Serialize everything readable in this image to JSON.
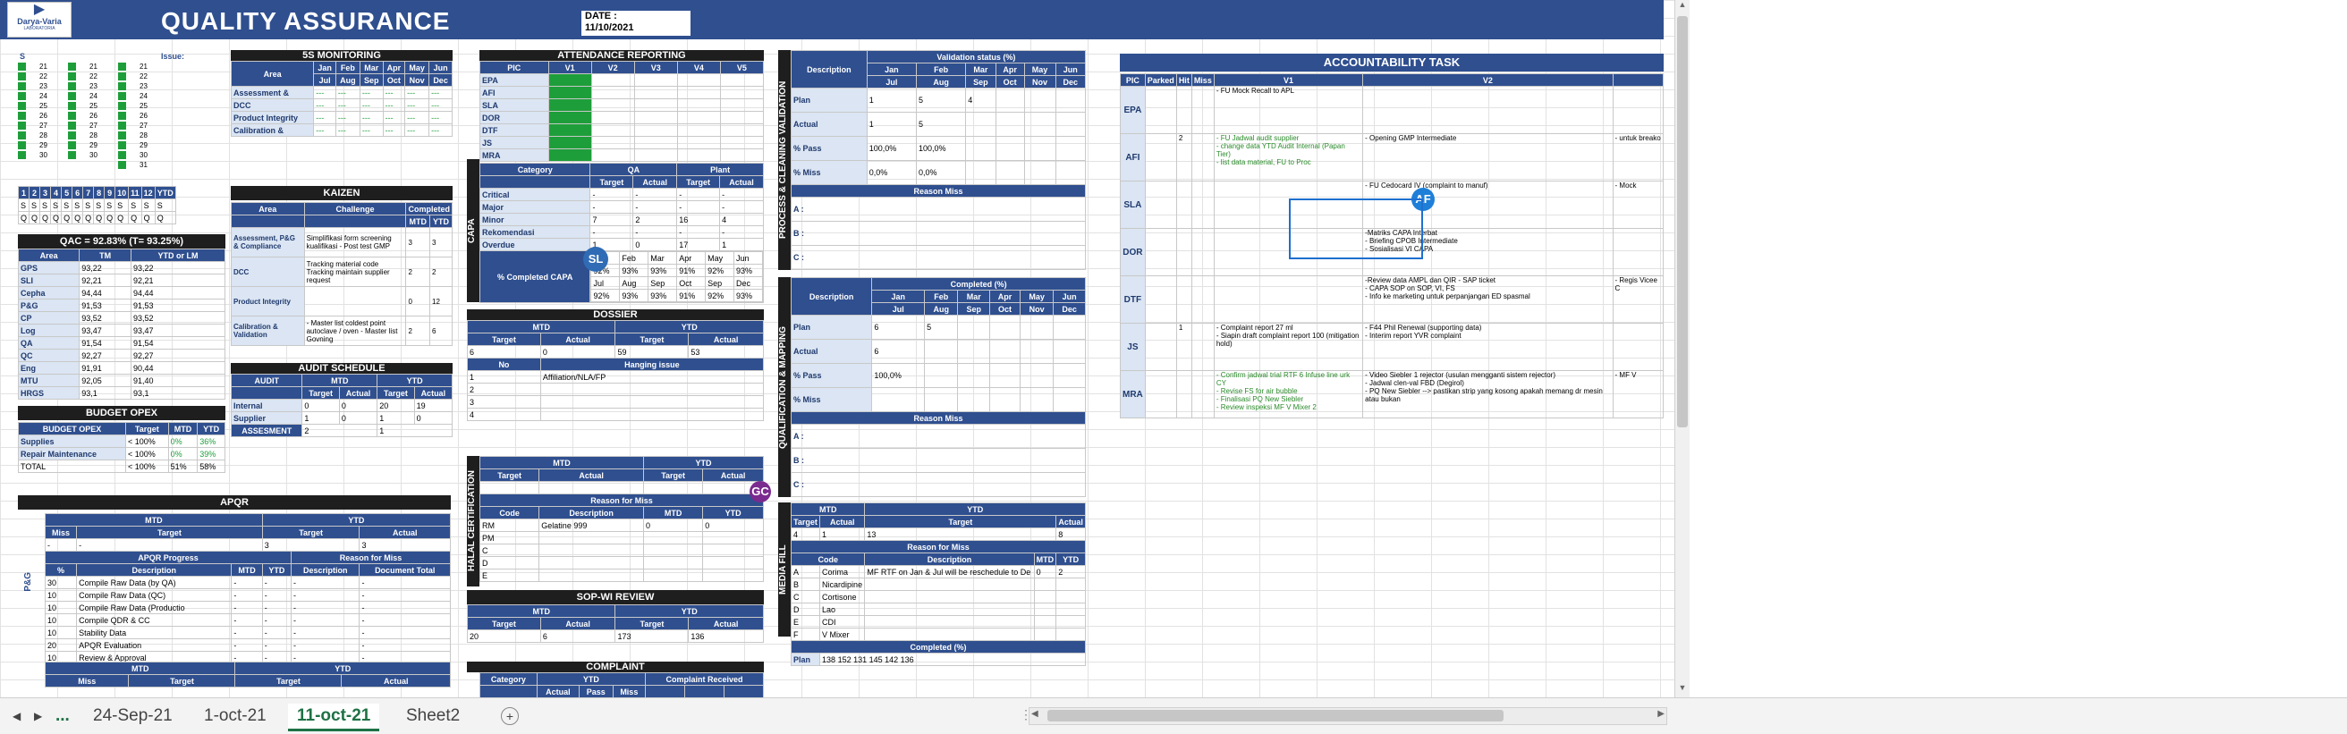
{
  "header": {
    "title": "QUALITY ASSURANCE",
    "logo_text": "Darya-Varia",
    "logo_sub": "LABORATORIA",
    "date_label": "DATE :",
    "date_value": "11/10/2021"
  },
  "calendar": {
    "issue_label": "Issue:",
    "col_s": "S",
    "col_q": "Q",
    "days": [
      "21",
      "22",
      "23",
      "24",
      "25",
      "26",
      "27",
      "28",
      "29",
      "30"
    ],
    "days2": [
      "21",
      "22",
      "23",
      "24",
      "25",
      "26",
      "27",
      "28",
      "29",
      "30"
    ],
    "days3": [
      "21",
      "22",
      "23",
      "24",
      "25",
      "26",
      "27",
      "28",
      "29",
      "30",
      "31"
    ]
  },
  "month_strip": {
    "months": [
      "1",
      "2",
      "3",
      "4",
      "5",
      "6",
      "7",
      "8",
      "9",
      "10",
      "11",
      "12",
      "YTD"
    ],
    "row_s": "S",
    "row_q": "Q"
  },
  "qac": {
    "title": "QAC = 92.83% (T= 93.25%)",
    "headers": [
      "Area",
      "TM",
      "YTD or LM"
    ],
    "rows": [
      [
        "GPS",
        "93,22",
        "93,22"
      ],
      [
        "SLI",
        "92,21",
        "92,21"
      ],
      [
        "Cepha",
        "94,44",
        "94,44"
      ],
      [
        "P&G",
        "91,53",
        "91,53"
      ],
      [
        "CP",
        "93,52",
        "93,52"
      ],
      [
        "Log",
        "93,47",
        "93,47"
      ],
      [
        "QA",
        "91,54",
        "91,54"
      ],
      [
        "QC",
        "92,27",
        "92,27"
      ],
      [
        "Eng",
        "91,91",
        "90,44"
      ],
      [
        "MTU",
        "92,05",
        "91,40"
      ],
      [
        "HRGS",
        "93,1",
        "93,1"
      ]
    ]
  },
  "budget": {
    "title": "BUDGET OPEX",
    "headers": [
      "BUDGET OPEX",
      "Target",
      "MTD",
      "YTD"
    ],
    "rows": [
      [
        "Supplies",
        "< 100%",
        "0%",
        "36%"
      ],
      [
        "Repair Maintenance",
        "< 100%",
        "0%",
        "39%"
      ]
    ],
    "total_label": "TOTAL",
    "total_target": "< 100%",
    "total_mtd": "51%",
    "total_ytd": "58%"
  },
  "s5": {
    "title": "5S MONITORING",
    "col_area": "Area",
    "months1": [
      "Jan",
      "Feb",
      "Mar",
      "Apr",
      "May",
      "Jun"
    ],
    "months2": [
      "Jul",
      "Aug",
      "Sep",
      "Oct",
      "Nov",
      "Dec"
    ],
    "rows": [
      "Assessment &",
      "DCC",
      "Product Integrity",
      "Calibration &"
    ],
    "dash": "---"
  },
  "kaizen": {
    "title": "KAIZEN",
    "headers": [
      "Area",
      "Challenge",
      "Completed",
      "MTD",
      "YTD"
    ],
    "rows": [
      [
        "Assessment, P&G & Compliance",
        "Simplifikasi form screening kualifikasi - Post test GMP",
        "3",
        "3"
      ],
      [
        "DCC",
        "Tracking material code Tracking maintain supplier request",
        "2",
        "2"
      ],
      [
        "Product Integrity",
        "",
        "0",
        "12"
      ],
      [
        "Calibration & Validation",
        "- Master list coldest point autoclave / oven - Master list Govning",
        "2",
        "6"
      ]
    ]
  },
  "audit": {
    "title": "AUDIT SCHEDULE",
    "label": "AUDIT",
    "mtd": "MTD",
    "ytd": "YTD",
    "target": "Target",
    "actual": "Actual",
    "rows": [
      [
        "Internal",
        "0",
        "0",
        "20",
        "19"
      ],
      [
        "Supplier",
        "1",
        "0",
        "1",
        "0"
      ]
    ],
    "assessment": "ASSESMENT",
    "a_target": "2",
    "a_actual": "1"
  },
  "attendance": {
    "title": "ATTENDANCE REPORTING",
    "pic": "PIC",
    "cols": [
      "V1",
      "V2",
      "V3",
      "V4",
      "V5"
    ],
    "rows": [
      "EPA",
      "AFI",
      "SLA",
      "DOR",
      "DTF",
      "JS",
      "MRA"
    ]
  },
  "capa": {
    "label": "CAPA",
    "category": "Category",
    "qa": "QA",
    "plant": "Plant",
    "target": "Target",
    "actual": "Actual",
    "rows": [
      [
        "Critical",
        "-",
        "-",
        "-",
        "-"
      ],
      [
        "Major",
        "-",
        "-",
        "-",
        "-"
      ],
      [
        "Minor",
        "7",
        "2",
        "16",
        "4"
      ],
      [
        "Rekomendasi",
        "-",
        "-",
        "-",
        "-"
      ],
      [
        "Overdue",
        "1",
        "0",
        "17",
        "1"
      ]
    ],
    "completed": "% Completed CAPA",
    "m1": [
      "Jan",
      "Feb",
      "Mar",
      "Apr",
      "May",
      "Jun"
    ],
    "v1": [
      "92%",
      "93%",
      "93%",
      "91%",
      "92%",
      "93%"
    ],
    "m2": [
      "Jul",
      "Aug",
      "Sep",
      "Oct",
      "Sep",
      "Dec"
    ],
    "v2": [
      "92%",
      "93%",
      "93%",
      "91%",
      "92%",
      "93%"
    ]
  },
  "dossier": {
    "title": "DOSSIER",
    "mtd": "MTD",
    "ytd": "YTD",
    "target": "Target",
    "actual": "Actual",
    "vals": [
      "6",
      "0",
      "59",
      "53"
    ],
    "no": "No",
    "hanging": "Hanging issue",
    "items": [
      "1",
      "2",
      "3",
      "4"
    ],
    "item1": "Affiliation/NLA/FP"
  },
  "halal": {
    "label": "HALAL CERTIFICATION",
    "mtd": "MTD",
    "ytd": "YTD",
    "target": "Target",
    "actual": "Actual",
    "reason": "Reason for Miss",
    "code": "Code",
    "desc": "Description",
    "codes": [
      "RM",
      "PM",
      "C",
      "D",
      "E"
    ],
    "rm_desc": "Gelatine 999",
    "mtd_v": "0",
    "ytd_v": "0"
  },
  "sop": {
    "title": "SOP-WI REVIEW",
    "mtd": "MTD",
    "ytd": "YTD",
    "target": "Target",
    "actual": "Actual",
    "vals": [
      "20",
      "6",
      "173",
      "136"
    ]
  },
  "complaint": {
    "title": "COMPLAINT",
    "category": "Category",
    "ytd": "YTD",
    "received": "Complaint Received",
    "sub": [
      "Actual",
      "Pass",
      "Miss"
    ]
  },
  "apqr": {
    "title": "APQR",
    "mtd": "MTD",
    "ytd": "YTD",
    "miss": "Miss",
    "target": "Target",
    "actual": "Actual",
    "vals": [
      "-",
      "-",
      "3",
      "3"
    ],
    "progress": "APQR Progress",
    "reason": "Reason for Miss",
    "headers": [
      "%",
      "Description",
      "MTD",
      "YTD",
      "Description",
      "Document Total"
    ],
    "side": "P&G",
    "rows": [
      [
        "30",
        "Compile Raw Data (by QA)"
      ],
      [
        "10",
        "Compile Raw Data (QC)"
      ],
      [
        "10",
        "Compile Raw Data (Productio"
      ],
      [
        "10",
        "Compile QDR & CC"
      ],
      [
        "10",
        "Stability Data"
      ],
      [
        "20",
        "APQR Evaluation"
      ],
      [
        "10",
        "Review & Approval"
      ]
    ]
  },
  "pcv": {
    "label": "PROCESS & CLEANING VALIDATION",
    "desc": "Description",
    "status": "Validation status (%)",
    "m1": [
      "Jan",
      "Feb",
      "Mar",
      "Apr",
      "May",
      "Jun"
    ],
    "m2": [
      "Jul",
      "Aug",
      "Sep",
      "Oct",
      "Nov",
      "Dec"
    ],
    "rows": [
      "Plan",
      "Actual",
      "% Pass",
      "% Miss"
    ],
    "plan": [
      "1",
      "5",
      "4"
    ],
    "actual": [
      "1",
      "5"
    ],
    "pass": [
      "100,0%",
      "100,0%"
    ],
    "miss": [
      "0,0%",
      "0,0%"
    ],
    "reason": "Reason Miss",
    "abc": [
      "A :",
      "B :",
      "C :"
    ]
  },
  "qm": {
    "label": "QUALIFICATION & MAPPING",
    "desc": "Description",
    "status": "Completed (%)",
    "rows": [
      "Plan",
      "Actual",
      "% Pass",
      "% Miss"
    ],
    "plan": [
      "6",
      "5"
    ],
    "actual": [
      "6"
    ],
    "pass": [
      "100,0%"
    ],
    "reason": "Reason Miss",
    "abc": [
      "A :",
      "B :",
      "C :"
    ]
  },
  "media": {
    "label": "MEDIA FILL",
    "mtd": "MTD",
    "ytd": "YTD",
    "target": "Target",
    "actual": "Actual",
    "vals": [
      "4",
      "1",
      "13",
      "8"
    ],
    "reason": "Reason for Miss",
    "code": "Code",
    "desc": "Description",
    "mtdc": "MTD",
    "ytdc": "YTD",
    "rows": [
      [
        "A",
        "Corima",
        "MF RTF on Jan & Jul will be reschedule to De",
        "0",
        "2"
      ],
      [
        "B",
        "Nicardipine",
        "",
        "",
        ""
      ],
      [
        "C",
        "Cortisone",
        "",
        "",
        ""
      ],
      [
        "D",
        "Lao",
        "",
        "",
        ""
      ],
      [
        "E",
        "CDI",
        "",
        "",
        ""
      ],
      [
        "F",
        "V Mixer",
        "",
        "",
        ""
      ]
    ],
    "completed": "Completed (%)",
    "plan": "Plan",
    "pvals": [
      "138",
      "152",
      "131",
      "145",
      "142",
      "136"
    ]
  },
  "account": {
    "title": "ACCOUNTABILITY TASK",
    "headers": [
      "PIC",
      "Parked",
      "Hit",
      "Miss",
      "V1",
      "V2"
    ],
    "rows": [
      {
        "pic": "EPA",
        "parked": "",
        "hit": "",
        "miss": "",
        "v1": "- FU Mock Recall to APL",
        "v2": "",
        "v3": ""
      },
      {
        "pic": "AFI",
        "parked": "",
        "hit": "2",
        "miss": "",
        "v1": "- FU Jadwal audit supplier\n- change data YTD Audit Internal (Papan Tier)\n- list data material, FU to Proc",
        "v2": "- Opening GMP Intermediate",
        "v3": "- untuk breako"
      },
      {
        "pic": "SLA",
        "parked": "",
        "hit": "",
        "miss": "",
        "v1": "",
        "v2": "- FU Cedocard IV (complaint to manuf)",
        "v3": "- Mock"
      },
      {
        "pic": "DOR",
        "parked": "",
        "hit": "",
        "miss": "",
        "v1": "",
        "v2": "-Matriks CAPA Interbat\n- Briefing CPOB Intermediate\n- Sosialisasi VI CAPA",
        "v3": ""
      },
      {
        "pic": "DTF",
        "parked": "",
        "hit": "",
        "miss": "",
        "v1": "",
        "v2": "-Review data AMPL dan QIR - SAP ticket\n- CAPA SOP on SOP, VI, FS\n- Info ke marketing untuk perpanjangan ED spasmal",
        "v3": "- Regis Vicee C"
      },
      {
        "pic": "JS",
        "parked": "",
        "hit": "1",
        "miss": "",
        "v1": "- Complaint report 27 ml\n- Siapin draft complaint report 100 (mitigation hold)",
        "v2": "- F44 Phil Renewal (supporting data)\n- Interim report YVR complaint",
        "v3": ""
      },
      {
        "pic": "MRA",
        "parked": "",
        "hit": "",
        "miss": "",
        "v1": "- Confirm jadwal trial RTF 6 Infuse line urk CY\n- Revise FS for air bubble\n- Finalisasi PQ New Siebler\n- Review inspeksi MF V Mixer 2",
        "v2": "- Video Siebler 1 rejector (usulan mengganti sistem rejector)\n- Jadwal clen-val FBD (Degirol)\n- PQ New Siebler --> pastikan strip yang kosong apakah memang dr mesin atau bukan",
        "v3": "- MF V"
      }
    ]
  },
  "avatars": {
    "sl": "SL",
    "gc": "GC",
    "af": "AF"
  },
  "tabs": {
    "more": "...",
    "items": [
      "24-Sep-21",
      "1-oct-21",
      "11-oct-21",
      "Sheet2"
    ],
    "add": "+"
  },
  "colors": {
    "navy": "#2f4f8f",
    "green": "#1e9e3a",
    "black": "#1e1e1e",
    "active_tab": "#1e7145"
  }
}
